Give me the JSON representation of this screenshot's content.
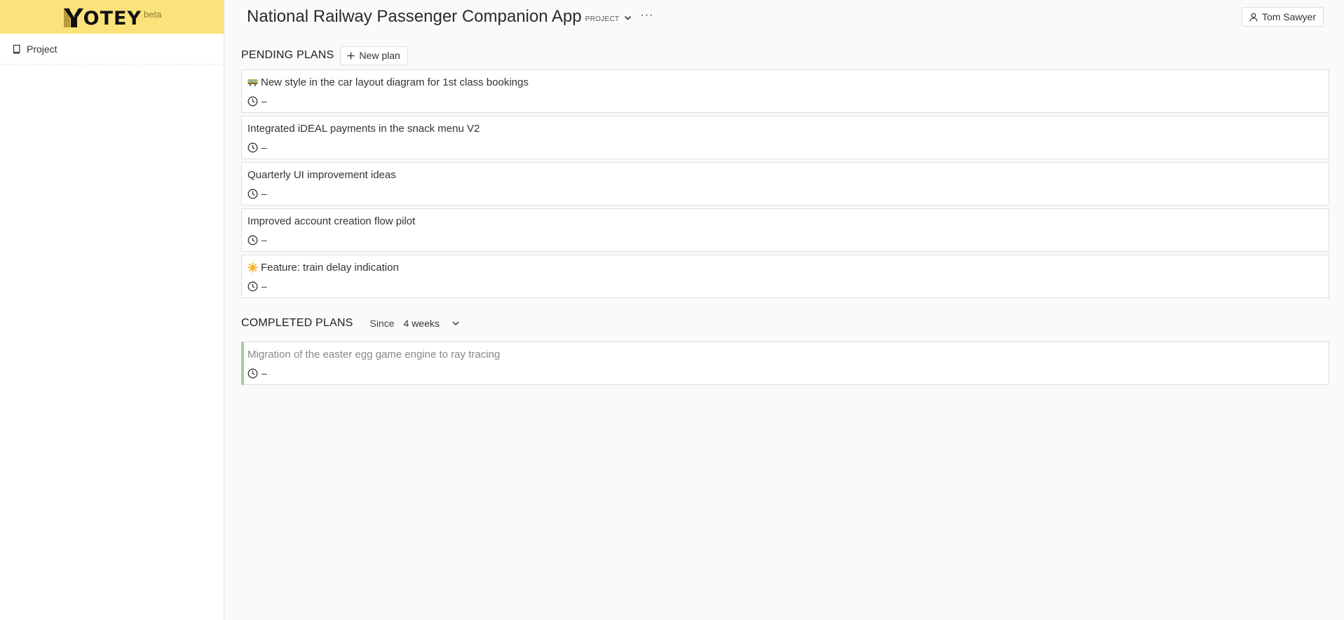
{
  "logo": {
    "text": "OTEY",
    "badge": "beta"
  },
  "sidebar": {
    "items": [
      {
        "label": "Project",
        "icon": "book-icon"
      }
    ]
  },
  "header": {
    "title": "National Railway Passenger Companion App",
    "type_label": "PROJECT",
    "more_label": "···",
    "user_name": "Tom Sawyer"
  },
  "pending": {
    "title": "PENDING PLANS",
    "new_label": "New plan",
    "plans": [
      {
        "title": "New style in the car layout diagram for 1st class bookings",
        "emoji": "train-car-icon",
        "time": "–"
      },
      {
        "title": "Integrated iDEAL payments in the snack menu V2",
        "emoji": "",
        "time": "–"
      },
      {
        "title": "Quarterly UI improvement ideas",
        "emoji": "",
        "time": "–"
      },
      {
        "title": "Improved account creation flow pilot",
        "emoji": "",
        "time": "–"
      },
      {
        "title": "Feature: train delay indication",
        "emoji": "sun-icon",
        "time": "–"
      }
    ]
  },
  "completed": {
    "title": "COMPLETED PLANS",
    "since_label": "Since",
    "since_value": "4 weeks",
    "plans": [
      {
        "title": "Migration of the easter egg game engine to ray tracing",
        "time": "–"
      }
    ]
  },
  "colors": {
    "logo_bg": "#fbe27a",
    "done_accent": "#9fd09a"
  }
}
